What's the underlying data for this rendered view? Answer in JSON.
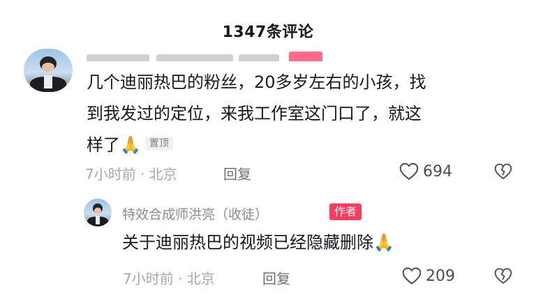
{
  "header": {
    "title": "1347条评论"
  },
  "comments": [
    {
      "text_line1": "几个迪丽热巴的粉丝，20多岁左右的小孩，找",
      "text_line2": "到我发过的定位，来我工作室这门口了，就这",
      "text_line3": "样了",
      "pinned_label": "置顶",
      "time_location": "7小时前 · 北京",
      "reply_label": "回复",
      "like_count": "694",
      "icons": {
        "like": "heart-outline-icon",
        "dislike": "broken-heart-icon",
        "emoji": "folded-hands-emoji"
      },
      "reply": {
        "author": "特效合成师洪亮（收徒）",
        "author_badge": "作者",
        "text": "关于迪丽热巴的视频已经隐藏删除",
        "time_location": "7小时前 · 北京",
        "reply_label": "回复",
        "like_count": "209"
      }
    }
  ],
  "colors": {
    "author_badge": "#ff3a5f",
    "text": "#161823",
    "meta": "#a8a9ad",
    "emoji": "#e8a93a"
  }
}
